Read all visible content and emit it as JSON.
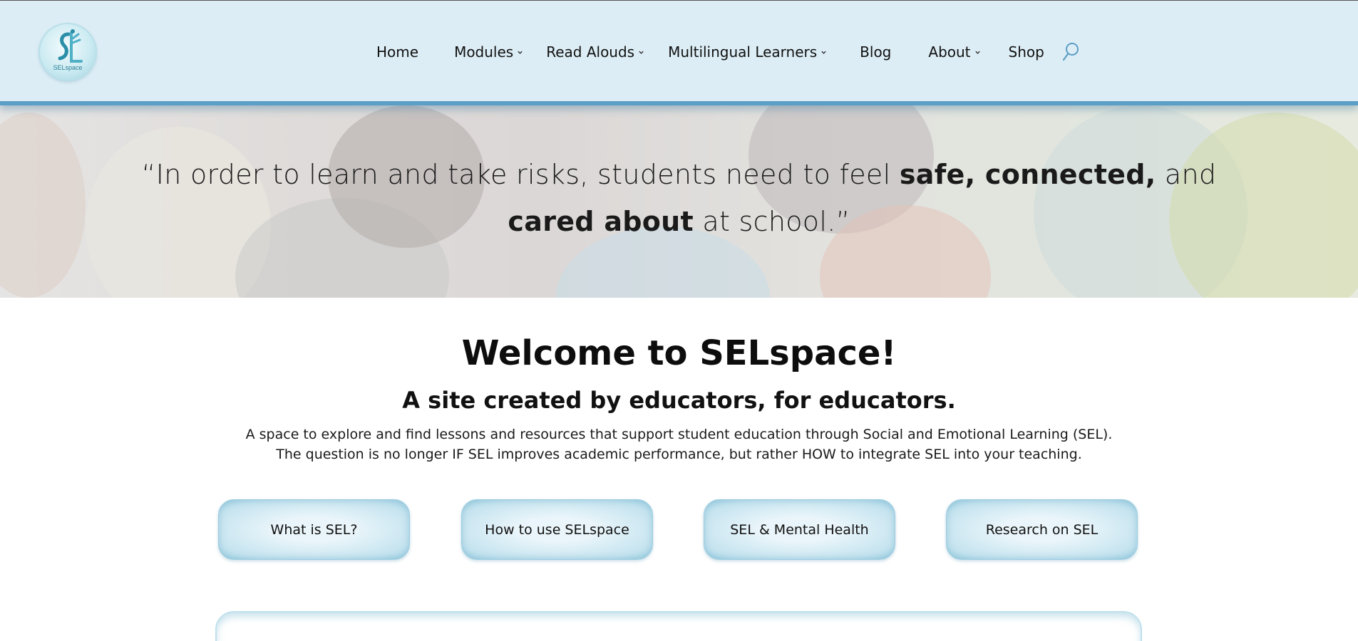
{
  "header": {
    "logo_text": "SELspace",
    "nav": [
      {
        "label": "Home",
        "has_dropdown": false
      },
      {
        "label": "Modules",
        "has_dropdown": true
      },
      {
        "label": "Read Alouds",
        "has_dropdown": true
      },
      {
        "label": "Multilingual Learners",
        "has_dropdown": true
      },
      {
        "label": "Blog",
        "has_dropdown": false
      },
      {
        "label": "About",
        "has_dropdown": true
      },
      {
        "label": "Shop",
        "has_dropdown": false
      }
    ],
    "search_icon": "search-icon"
  },
  "hero": {
    "quote_part1": "“In order to learn and take risks, students need to feel ",
    "quote_bold1": "safe, connected,",
    "quote_part2": " and",
    "quote_bold2": "cared about",
    "quote_part3": " at school.”"
  },
  "main": {
    "welcome": "Welcome to SELspace!",
    "tagline": "A site created by educators, for educators.",
    "desc_line1": "A space to explore and find lessons and resources that support student education through Social and Emotional Learning (SEL).",
    "desc_line2": "The question is no longer IF SEL improves academic performance, but rather HOW to integrate SEL into your teaching.",
    "buttons": [
      {
        "label": "What is SEL?"
      },
      {
        "label": "How to use SELspace"
      },
      {
        "label": "SEL & Mental Health"
      },
      {
        "label": "Research on SEL"
      }
    ]
  },
  "colors": {
    "header_bg": "#dcedf5",
    "header_border": "#5b9ec6",
    "button_bg": "#c4e3ef",
    "accent": "#5b9ec6"
  }
}
